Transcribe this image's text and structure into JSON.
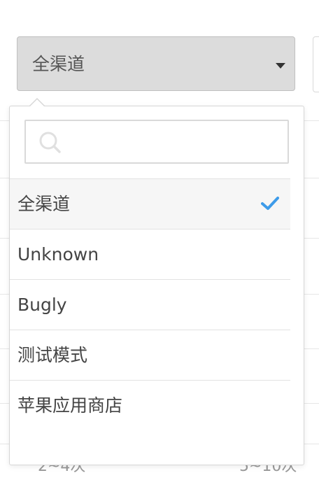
{
  "select": {
    "value": "全渠道"
  },
  "search": {
    "value": "",
    "placeholder": ""
  },
  "options": [
    {
      "label": "全渠道",
      "selected": true
    },
    {
      "label": "Unknown",
      "selected": false
    },
    {
      "label": "Bugly",
      "selected": false
    },
    {
      "label": "测试模式",
      "selected": false
    },
    {
      "label": "苹果应用商店",
      "selected": false
    }
  ],
  "background": {
    "footer_left": "2~4次",
    "footer_right": "5~10次"
  },
  "colors": {
    "check": "#3d9be9",
    "trigger_bg": "#dcdcdc",
    "selected_bg": "#f6f6f6"
  }
}
